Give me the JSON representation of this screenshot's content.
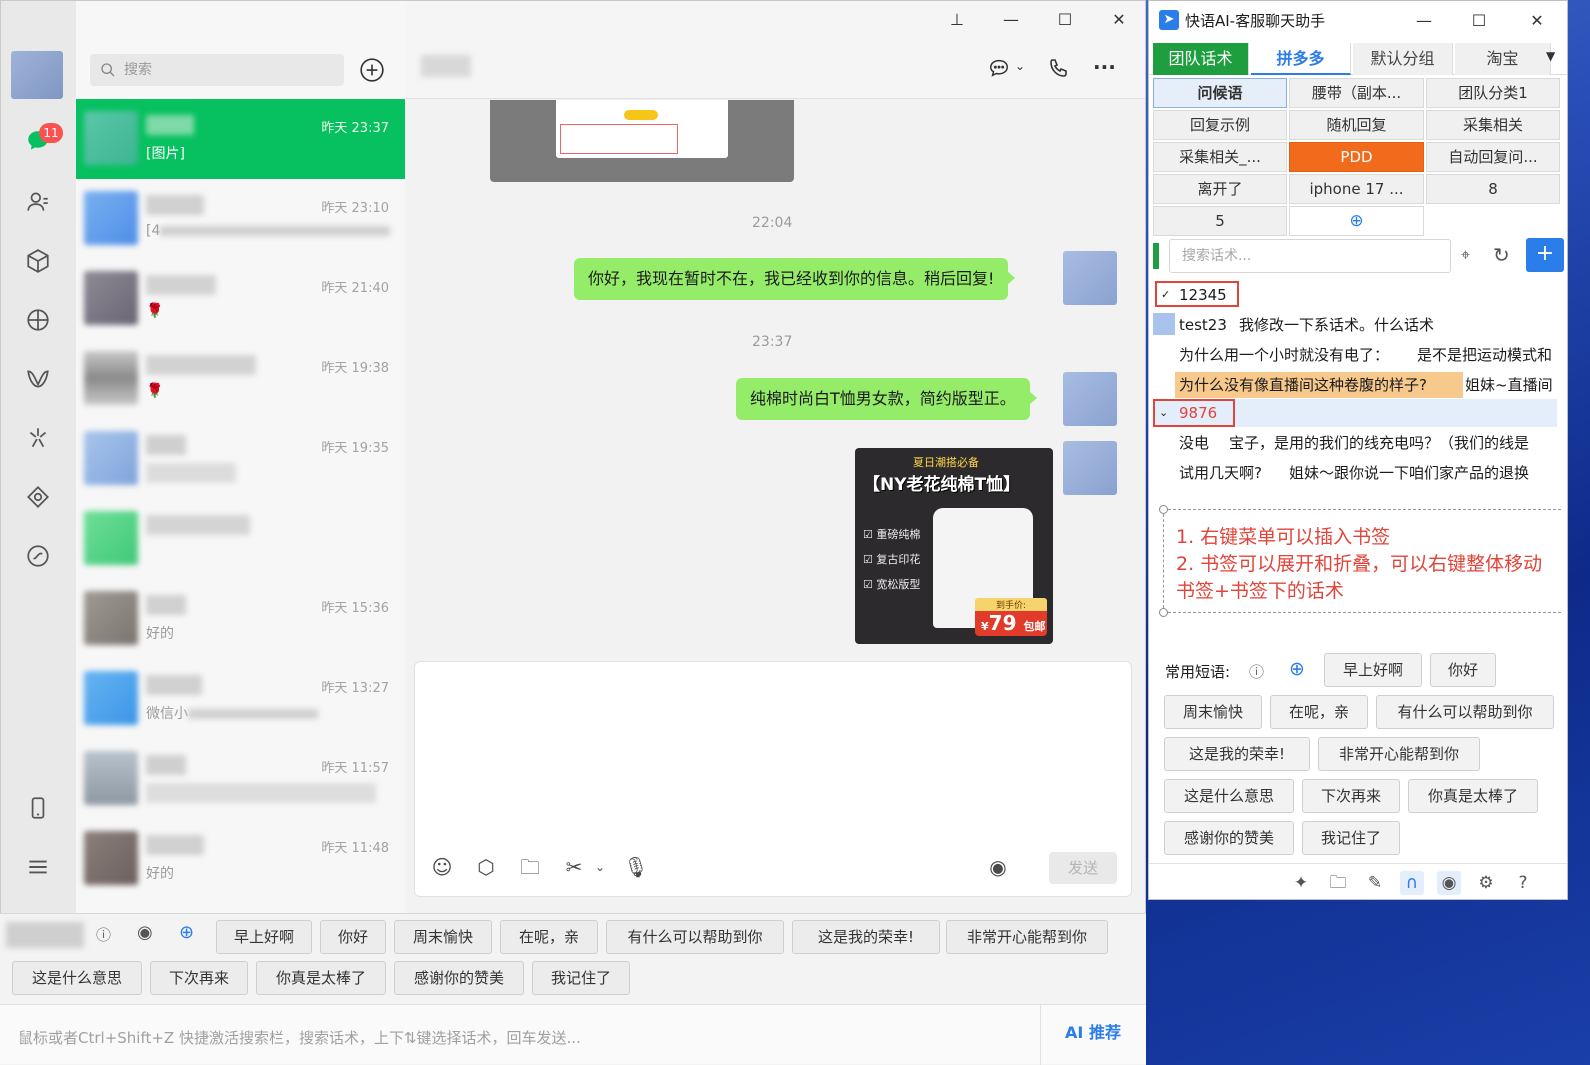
{
  "wechat": {
    "search_placeholder": "搜索",
    "unread_badge": "11",
    "chats": [
      {
        "time": "昨天 23:37",
        "msg": "[图片]"
      },
      {
        "time": "昨天 23:10",
        "msg": "[4"
      },
      {
        "time": "昨天 21:40",
        "msg": "🌹"
      },
      {
        "time": "昨天 19:38",
        "msg": "🌹"
      },
      {
        "time": "昨天 19:35",
        "msg": ""
      },
      {
        "time": "",
        "msg": ""
      },
      {
        "time": "昨天 15:36",
        "msg": "好的"
      },
      {
        "time": "昨天 13:27",
        "msg": "微信小"
      },
      {
        "time": "昨天 11:57",
        "msg": ""
      },
      {
        "time": "昨天 11:48",
        "msg": "好的"
      }
    ],
    "messages": {
      "time1": "22:04",
      "msg1": "你好，我现在暂时不在，我已经收到你的信息。稍后回复!",
      "time2": "23:37",
      "msg2": "纯棉时尚白T恤男女款，简约版型正。"
    },
    "product": {
      "tag": "夏日潮搭必备",
      "title": "【NY老花纯棉T恤】",
      "features": [
        "重磅纯棉",
        "复古印花",
        "宽松版型"
      ],
      "price_label": "到手价:",
      "price": "79",
      "currency": "¥",
      "shipping": "包邮"
    },
    "send_label": "发送"
  },
  "quickbar": {
    "row1": [
      "早上好啊",
      "你好",
      "周末愉快",
      "在呢，亲",
      "有什么可以帮助到你",
      "这是我的荣幸!",
      "非常开心能帮到你"
    ],
    "row2": [
      "这是什么意思",
      "下次再来",
      "你真是太棒了",
      "感谢你的赞美",
      "我记住了"
    ],
    "hint": "鼠标或者Ctrl+Shift+Z 快捷激活搜索栏，搜索话术，上下⇅键选择话术，回车发送...",
    "ai_label": "AI 推荐"
  },
  "assistant": {
    "title": "快语AI-客服聊天助手",
    "tabs": [
      "团队话术",
      "拼多多",
      "默认分组",
      "淘宝"
    ],
    "categories": [
      "问候语",
      "腰带（副本...",
      "团队分类1",
      "回复示例",
      "随机回复",
      "采集相关",
      "采集相关_...",
      "PDD",
      "自动回复问...",
      "离开了",
      "iphone 17 ...",
      "8",
      "5"
    ],
    "search_placeholder": "搜索话术...",
    "tree": {
      "bookmark1": "12345",
      "row1_title": "test23",
      "row1_text": "我修改一下系话术。什么话术",
      "row2_title": "为什么用一个小时就没有电了：",
      "row2_text": "是不是把运动模式和",
      "row3_title": "为什么没有像直播间这种卷腹的样子?",
      "row3_text": "姐妹~直播间",
      "bookmark2": "9876",
      "row4_title": "没电",
      "row4_text": "宝子，是用的我们的线充电吗？（我们的线是",
      "row5_title": "试用几天啊?",
      "row5_text": "姐妹～跟你说一下咱们家产品的退换"
    },
    "notes": [
      "1. 右键菜单可以插入书签",
      "2. 书签可以展开和折叠，可以右键整体移动",
      "书签+书签下的话术"
    ],
    "phrases_label": "常用短语:",
    "phrases": [
      "早上好啊",
      "你好",
      "周末愉快",
      "在呢，亲",
      "有什么可以帮助到你",
      "这是我的荣幸!",
      "非常开心能帮到你",
      "这是什么意思",
      "下次再来",
      "你真是太棒了",
      "感谢你的赞美",
      "我记住了"
    ]
  },
  "colors": {
    "wechat_green": "#07c160",
    "bubble_green": "#95ec69",
    "accent_blue": "#2b7de9",
    "note_red": "#e0443a",
    "pdd_orange": "#f26b1d"
  }
}
